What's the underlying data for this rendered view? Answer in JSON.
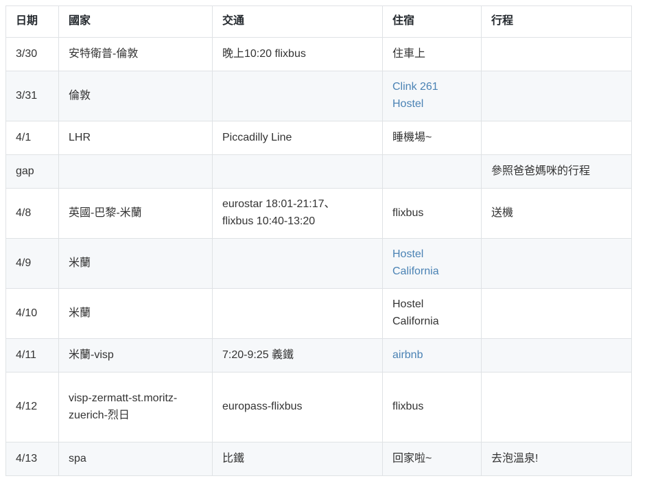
{
  "table": {
    "headers": [
      {
        "label": "日期",
        "name": "col-date"
      },
      {
        "label": "國家",
        "name": "col-country"
      },
      {
        "label": "交通",
        "name": "col-transport"
      },
      {
        "label": "住宿",
        "name": "col-accommodation"
      },
      {
        "label": "行程",
        "name": "col-itinerary"
      }
    ],
    "link_color": "#4a82b4",
    "border_color": "#dfe2e5",
    "alt_row_color": "#f6f8fa",
    "text_color": "#333333",
    "rows": [
      {
        "date": "3/30",
        "country": "安特衛普-倫敦",
        "transport": "晚上10:20 flixbus",
        "accommodation": "住車上",
        "accommodation_is_link": false,
        "itinerary": ""
      },
      {
        "date": "3/31",
        "country": "倫敦",
        "transport": "",
        "accommodation": "Clink 261 Hostel",
        "accommodation_is_link": true,
        "itinerary": ""
      },
      {
        "date": "4/1",
        "country": "LHR",
        "transport": "Piccadilly Line",
        "accommodation": "睡機場~",
        "accommodation_is_link": false,
        "itinerary": ""
      },
      {
        "date": "gap",
        "country": "",
        "transport": "",
        "accommodation": "",
        "accommodation_is_link": false,
        "itinerary": "參照爸爸媽咪的行程"
      },
      {
        "date": "4/8",
        "country": "英國-巴黎-米蘭",
        "transport_line1": "eurostar 18:01-21:17、",
        "transport_line2": "flixbus 10:40-13:20",
        "transport": "",
        "accommodation": "flixbus",
        "accommodation_is_link": false,
        "itinerary": "送機"
      },
      {
        "date": "4/9",
        "country": "米蘭",
        "transport": "",
        "accommodation": "Hostel California",
        "accommodation_is_link": true,
        "itinerary": ""
      },
      {
        "date": "4/10",
        "country": "米蘭",
        "transport": "",
        "accommodation": "Hostel California",
        "accommodation_is_link": false,
        "itinerary": ""
      },
      {
        "date": "4/11",
        "country": "米蘭-visp",
        "transport": "7:20-9:25 義鐵",
        "accommodation": "airbnb",
        "accommodation_is_link": true,
        "itinerary": ""
      },
      {
        "date": "4/12",
        "country": "visp-zermatt-st.moritz-zuerich-烈日",
        "transport": "europass-flixbus",
        "accommodation": "flixbus",
        "accommodation_is_link": false,
        "itinerary": ""
      },
      {
        "date": "4/13",
        "country": "spa",
        "transport": "比鐵",
        "accommodation": "回家啦~",
        "accommodation_is_link": false,
        "itinerary": "去泡溫泉!"
      }
    ]
  }
}
